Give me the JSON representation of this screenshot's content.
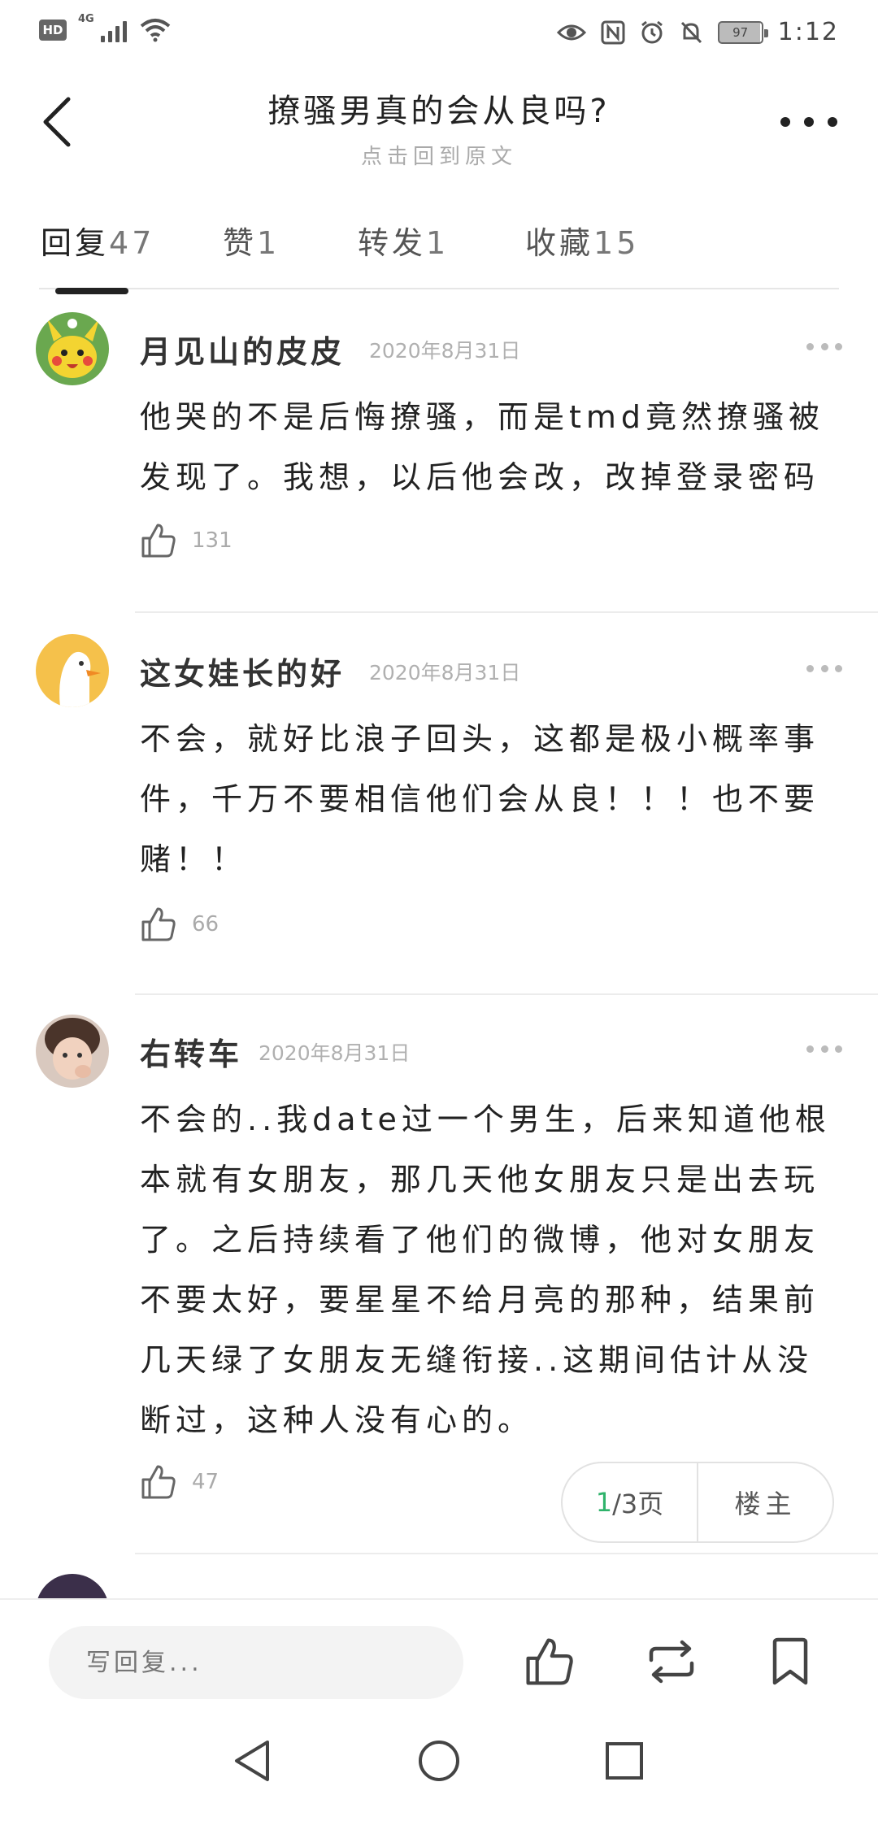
{
  "status_bar": {
    "network_tag": "HD",
    "signal_tag": "4G",
    "battery": "97",
    "time": "1:12"
  },
  "header": {
    "title": "撩骚男真的会从良吗?",
    "subtitle": "点击回到原文"
  },
  "tabs": [
    {
      "label": "回复",
      "count": "47"
    },
    {
      "label": "赞",
      "count": "1"
    },
    {
      "label": "转发",
      "count": "1"
    },
    {
      "label": "收藏",
      "count": "15"
    }
  ],
  "comments": [
    {
      "name": "月见山的皮皮",
      "date": "2020年8月31日",
      "lines": [
        "他哭的不是后悔撩骚，而是tmd竟然撩骚被",
        "发现了。我想，以后他会改，改掉登录密码"
      ],
      "likes": "131"
    },
    {
      "name": "这女娃长的好",
      "date": "2020年8月31日",
      "lines": [
        "不会，就好比浪子回头，这都是极小概率事",
        "件，千万不要相信他们会从良！！！也不要",
        "赌！！"
      ],
      "likes": "66"
    },
    {
      "name": "右转车",
      "date": "2020年8月31日",
      "lines": [
        "不会的..我date过一个男生，后来知道他根",
        "本就有女朋友，那几天他女朋友只是出去玩",
        "了。之后持续看了他们的微博，他对女朋友",
        "不要太好，要星星不给月亮的那种，结果前",
        "几天绿了女朋友无缝衔接..这期间估计从没",
        "断过，这种人没有心的。"
      ],
      "likes": "47"
    }
  ],
  "pager": {
    "current": "1",
    "total_label": "/3页",
    "owner_label": "楼主"
  },
  "bottom_bar": {
    "reply_placeholder": "写回复..."
  }
}
